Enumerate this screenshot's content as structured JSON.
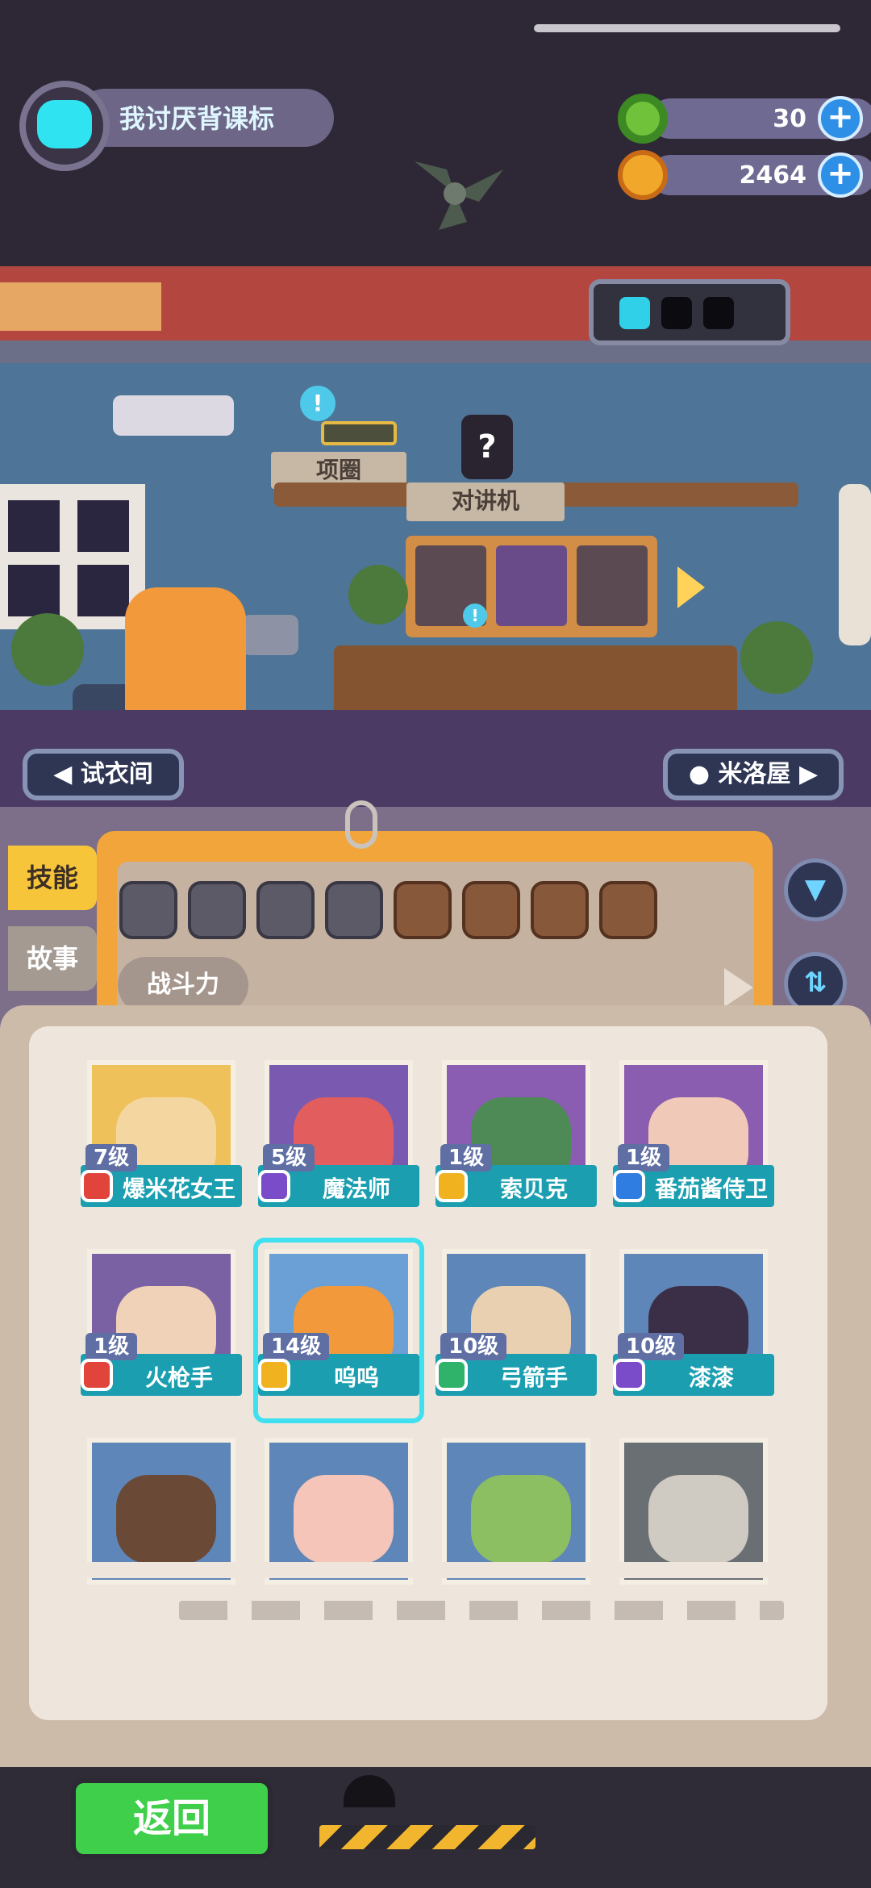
{
  "status": {
    "home_indicator": "home-indicator"
  },
  "profile": {
    "name": "我讨厌背课标",
    "avatar_icon": "cyan-cat-avatar"
  },
  "currency": [
    {
      "icon": "green-donut-icon",
      "value": "30",
      "add": "+"
    },
    {
      "icon": "gold-planet-coin-icon",
      "value": "2464",
      "add": "+"
    }
  ],
  "room": {
    "alert": "!",
    "collar_tag": "项圈",
    "mystery": "?",
    "walkie_tag": "对讲机",
    "frame_alert": "!",
    "left_nav": "试衣间",
    "right_nav": "米洛屋"
  },
  "side_tabs": [
    {
      "label": "技能"
    },
    {
      "label": "故事"
    }
  ],
  "filter": {
    "power_label": "战斗力",
    "skill_icons": [
      "heart-icon",
      "bell-icon",
      "shield-icon",
      "anchor-icon",
      "hand-icon",
      "smile-icon",
      "muscle-icon",
      "brain-icon"
    ],
    "filter_button": "filter-icon",
    "sort_button": "sort-icon"
  },
  "characters": [
    {
      "level": "7级",
      "name": "爆米花女王",
      "badge_color": "#e0443a"
    },
    {
      "level": "5级",
      "name": "魔法师",
      "badge_color": "#7a4cc9"
    },
    {
      "level": "1级",
      "name": "索贝克",
      "badge_color": "#f0b21f"
    },
    {
      "level": "1级",
      "name": "番茄酱侍卫",
      "badge_color": "#2f7de0"
    },
    {
      "level": "1级",
      "name": "火枪手",
      "badge_color": "#e0443a"
    },
    {
      "level": "14级",
      "name": "呜呜",
      "badge_color": "#f0b21f"
    },
    {
      "level": "10级",
      "name": "弓箭手",
      "badge_color": "#2fb36a"
    },
    {
      "level": "10级",
      "name": "漆漆",
      "badge_color": "#7a4cc9"
    },
    {
      "level": "",
      "name": "",
      "badge_color": "#e0443a"
    },
    {
      "level": "",
      "name": "",
      "badge_color": "#e0443a"
    },
    {
      "level": "",
      "name": "",
      "badge_color": "#e0443a"
    },
    {
      "level": "",
      "name": "",
      "badge_color": "#e0443a"
    }
  ],
  "footer": {
    "back_label": "返回"
  }
}
